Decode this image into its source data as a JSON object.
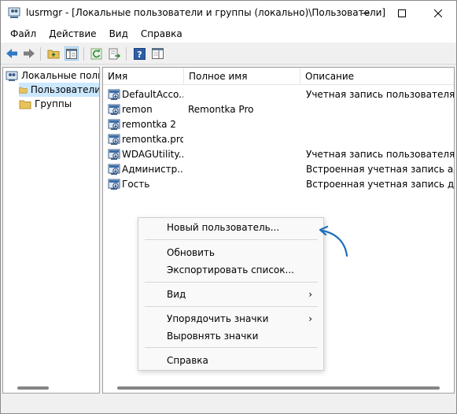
{
  "window": {
    "title": "lusrmgr - [Локальные пользователи и группы (локально)\\Пользователи]"
  },
  "menubar": {
    "items": [
      "Файл",
      "Действие",
      "Вид",
      "Справка"
    ]
  },
  "tree": {
    "root": "Локальные польз",
    "items": [
      {
        "label": "Пользователи",
        "selected": true
      },
      {
        "label": "Группы",
        "selected": false
      }
    ]
  },
  "list": {
    "columns": [
      "Имя",
      "Полное имя",
      "Описание"
    ],
    "rows": [
      {
        "name": "DefaultAcco...",
        "fullname": "",
        "description": "Учетная запись пользователя, у..."
      },
      {
        "name": "remon",
        "fullname": "Remontka Pro",
        "description": ""
      },
      {
        "name": "remontka 2",
        "fullname": "",
        "description": ""
      },
      {
        "name": "remontka.pro",
        "fullname": "",
        "description": ""
      },
      {
        "name": "WDAGUtility...",
        "fullname": "",
        "description": "Учетная запись пользователя, к..."
      },
      {
        "name": "Администр...",
        "fullname": "",
        "description": "Встроенная учетная запись адм..."
      },
      {
        "name": "Гость",
        "fullname": "",
        "description": "Встроенная учетная запись для ..."
      }
    ]
  },
  "context_menu": {
    "new_user": "Новый пользователь...",
    "refresh": "Обновить",
    "export": "Экспортировать список...",
    "view": "Вид",
    "arrange": "Упорядочить значки",
    "align": "Выровнять значки",
    "help": "Справка",
    "submenu_glyph": "›"
  },
  "colors": {
    "accent": "#1e6fb8",
    "selection": "#cce8ff",
    "folder": "#e8c25a"
  }
}
